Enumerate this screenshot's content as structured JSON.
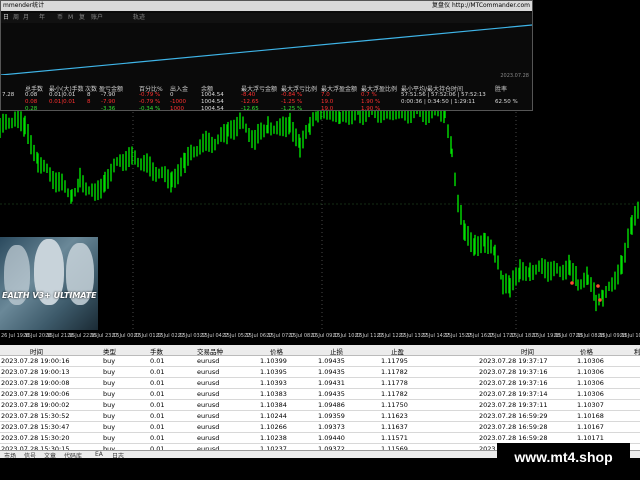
{
  "overlay": {
    "title": "mmender统计",
    "site": "复盘仪 http://MTCommander.com",
    "tabs": [
      "日",
      "周",
      "月",
      "年",
      "币",
      "M",
      "复",
      "账户",
      "轨迹"
    ],
    "date": "2023.07.28",
    "headers": [
      "总手数",
      "最小(大)手数",
      "次数",
      "盈亏金额",
      "百分比%",
      "出入金",
      "余额",
      "最大浮亏金额",
      "最大浮亏比例",
      "最大浮盈金额",
      "最大浮盈比例",
      "最小平均/最大持仓时间",
      "胜率"
    ],
    "row1": {
      "date": "7.28",
      "lots": "0.08",
      "minmax": "0.01|0.01",
      "count": "8",
      "pl": "-7.90",
      "pct": "-0.79 %",
      "io": "0",
      "balance": "1004.54",
      "maxloss": "-8.40",
      "maxloss_pct": "-0.84 %",
      "maxprofit": "7.0",
      "maxprofit_pct": "0.7 %",
      "time": "57:51:56 | 57:52:06 | 57:52:13"
    },
    "row2": {
      "lots": "0.08",
      "minmax": "0.01|0.01",
      "count": "8",
      "pl": "-7.90",
      "pct": "-0.79 %",
      "io": "-1000",
      "balance": "1004.54",
      "maxloss": "-12.65",
      "maxloss_pct": "-1.25 %",
      "maxprofit": "19.0",
      "maxprofit_pct": "1.90 %",
      "time": "0:00:36 | 0:34:50 | 1:29:11",
      "winrate": "62.50 %"
    },
    "row3": {
      "lots": "0.28",
      "pl": "-3.36",
      "pct": "-0.34 %",
      "io": "1000",
      "balance": "1004.54",
      "maxloss": "-12.65",
      "maxloss_pct": "-1.25 %",
      "maxprofit": "19.0",
      "maxprofit_pct": "1.90 %"
    }
  },
  "ad": {
    "text": "EALTH V3+ ULTIMATE"
  },
  "time_axis": [
    "26 Jul 19:15",
    "26 Jul 20:15",
    "26 Jul 21:15",
    "26 Jul 22:15",
    "26 Jul 23:15",
    "27 Jul 00:15",
    "27 Jul 01:15",
    "27 Jul 02:15",
    "27 Jul 03:15",
    "27 Jul 04:15",
    "27 Jul 05:15",
    "27 Jul 06:15",
    "27 Jul 07:15",
    "27 Jul 08:15",
    "27 Jul 09:15",
    "27 Jul 10:15",
    "27 Jul 11:15",
    "27 Jul 12:15",
    "27 Jul 13:15",
    "27 Jul 14:15",
    "27 Jul 15:15",
    "27 Jul 16:15",
    "27 Jul 17:15",
    "27 Jul 18:15",
    "27 Jul 19:15",
    "28 Jul 07:15",
    "28 Jul 08:15",
    "28 Jul 09:15",
    "28 Jul 10:15"
  ],
  "table": {
    "headers": [
      "时间",
      "类型",
      "手数",
      "交易品种",
      "价格",
      "止损",
      "止盈",
      "时间",
      "价格",
      "利"
    ],
    "rows": [
      [
        "2023.07.28 19:00:16",
        "buy",
        "0.01",
        "eurusd",
        "1.10399",
        "1.09435",
        "1.11795",
        "2023.07.28 19:37:17",
        "1.10306"
      ],
      [
        "2023.07.28 19:00:13",
        "buy",
        "0.01",
        "eurusd",
        "1.10395",
        "1.09435",
        "1.11782",
        "2023.07.28 19:37:16",
        "1.10306"
      ],
      [
        "2023.07.28 19:00:08",
        "buy",
        "0.01",
        "eurusd",
        "1.10393",
        "1.09431",
        "1.11778",
        "2023.07.28 19:37:16",
        "1.10306"
      ],
      [
        "2023.07.28 19:00:06",
        "buy",
        "0.01",
        "eurusd",
        "1.10383",
        "1.09435",
        "1.11782",
        "2023.07.28 19:37:14",
        "1.10306"
      ],
      [
        "2023.07.28 19:00:02",
        "buy",
        "0.01",
        "eurusd",
        "1.10384",
        "1.09486",
        "1.11750",
        "2023.07.28 19:37:11",
        "1.10307"
      ],
      [
        "2023.07.28 15:30:52",
        "buy",
        "0.01",
        "eurusd",
        "1.10244",
        "1.09359",
        "1.11623",
        "2023.07.28 16:59:29",
        "1.10168"
      ],
      [
        "2023.07.28 15:30:47",
        "buy",
        "0.01",
        "eurusd",
        "1.10266",
        "1.09373",
        "1.11637",
        "2023.07.28 16:59:28",
        "1.10167"
      ],
      [
        "2023.07.28 15:30:20",
        "buy",
        "0.01",
        "eurusd",
        "1.10238",
        "1.09440",
        "1.11571",
        "2023.07.28 16:59:28",
        "1.10171"
      ],
      [
        "2023.07.28 15:30:15",
        "buy",
        "0.01",
        "eurusd",
        "1.10237",
        "1.09372",
        "1.11569",
        "2023.07.28 16:59:27",
        "1.10172"
      ]
    ]
  },
  "bottom_tabs": [
    "市场",
    "信号",
    "文章",
    "代码库",
    "EA",
    "日志"
  ],
  "watermark": "www.mt4.shop",
  "colors": {
    "candle": "#00e000",
    "balance_line": "#3fb5e8",
    "grid": "#2a5a2a"
  }
}
